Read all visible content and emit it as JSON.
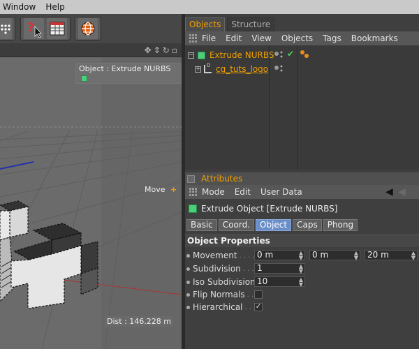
{
  "menubar": {
    "items": [
      "Window",
      "Help"
    ]
  },
  "viewport": {
    "camera_label": "Object : Extrude NURBS",
    "move_label": "Move",
    "dist_label": "Dist : 146.228 m"
  },
  "panel_tabs": [
    "Objects",
    "Structure"
  ],
  "objects_menu": [
    "File",
    "Edit",
    "View",
    "Objects",
    "Tags",
    "Bookmarks"
  ],
  "objects": [
    {
      "name": "Extrude NURBS"
    },
    {
      "name": "cg_tuts_logo"
    }
  ],
  "attributes": {
    "title": "Attributes",
    "menu": [
      "Mode",
      "Edit",
      "User Data"
    ],
    "object_heading": "Extrude Object [Extrude NURBS]",
    "tabs": [
      "Basic",
      "Coord.",
      "Object",
      "Caps",
      "Phong"
    ],
    "active_tab": "Object",
    "section": "Object Properties",
    "props": {
      "movement_label": "Movement",
      "movement_x": "0 m",
      "movement_y": "0 m",
      "movement_z": "20 m",
      "subdivision_label": "Subdivision",
      "subdivision": "1",
      "iso_label": "Iso Subdivision",
      "iso": "10",
      "flip_label": "Flip Normals",
      "flip_checked": false,
      "hier_label": "Hierarchical",
      "hier_checked": true
    }
  },
  "colors": {
    "accent": "#f0a000",
    "selected_tab": "#6a8ec8",
    "viewport_bg": "#666666"
  }
}
